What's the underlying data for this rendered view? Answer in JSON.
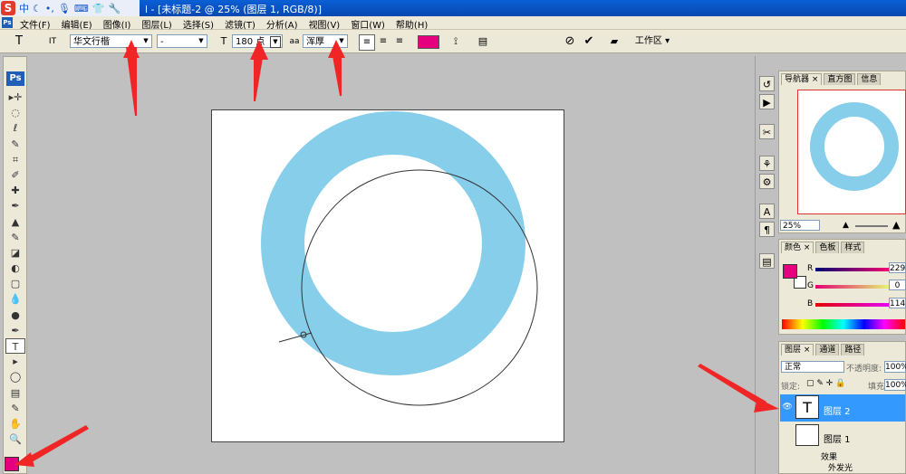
{
  "titlebar": {
    "ime_logo": "S",
    "ime_char": "中",
    "title": "l - [未标题-2 @ 25% (图层 1, RGB/8)]"
  },
  "menubar": {
    "app_icon": "Ps",
    "items": [
      "文件(F)",
      "编辑(E)",
      "图像(I)",
      "图层(L)",
      "选择(S)",
      "滤镜(T)",
      "分析(A)",
      "视图(V)",
      "窗口(W)",
      "帮助(H)"
    ]
  },
  "options": {
    "tool_icon": "T",
    "orient_icon": "IT",
    "font_family": "华文行楷",
    "font_style": "-",
    "size_icon": "T",
    "font_size": "180 点",
    "aa_icon": "aa",
    "antialias": "浑厚",
    "text_color": "#e4007f",
    "workspace": "工作区 ▾"
  },
  "toolbox": {
    "logo": "Ps",
    "tools": [
      "▸✛",
      "◌",
      "ℓ",
      "✎",
      "⌗",
      "✐",
      "✚",
      "✒",
      "▲",
      "✎",
      "◪",
      "◐",
      "▢",
      "💧",
      "●",
      "✒",
      "T",
      "▸",
      "◯",
      "▤",
      "✎",
      "✋",
      "🔍"
    ],
    "active_index": 16,
    "foreground": "#e4007f"
  },
  "artwork": {
    "ring_color": "#87ceeb"
  },
  "navigator": {
    "tabs": [
      "导航器 ×",
      "直方图",
      "信息"
    ],
    "zoom": "25%"
  },
  "color_panel": {
    "tabs": [
      "颜色 ×",
      "色板",
      "样式"
    ],
    "channels": [
      {
        "label": "R",
        "value": "229"
      },
      {
        "label": "G",
        "value": "0"
      },
      {
        "label": "B",
        "value": "114"
      }
    ],
    "swatch": "#e4007f"
  },
  "layers_panel": {
    "tabs": [
      "图层 ×",
      "通道",
      "路径"
    ],
    "blend_mode": "正常",
    "opacity_label": "不透明度:",
    "opacity": "100%",
    "lock_label": "锁定:",
    "fill_label": "填充:",
    "fill": "100%",
    "layers": [
      {
        "name": "图层 2",
        "thumb": "T",
        "selected": true
      },
      {
        "name": "图层 1",
        "thumb": "",
        "selected": false
      }
    ],
    "effects_label": "效果",
    "effect": "外发光"
  }
}
